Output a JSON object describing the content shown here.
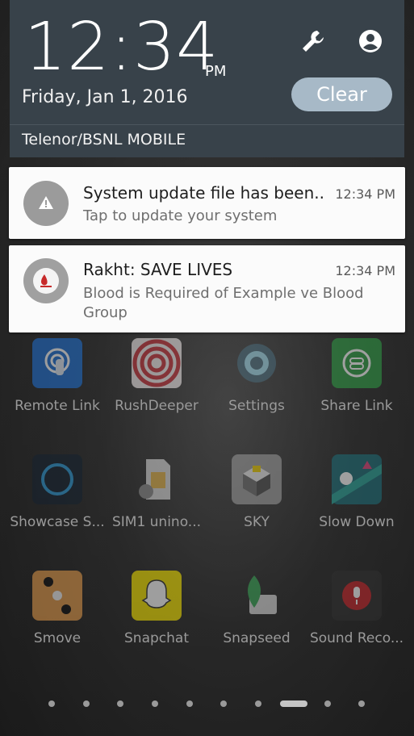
{
  "shade": {
    "time": "12:34",
    "ampm": "PM",
    "date": "Friday, Jan 1, 2016",
    "clear_label": "Clear",
    "carrier": "Telenor/BSNL MOBILE"
  },
  "notifications": [
    {
      "title": "System update file has been..",
      "time": "12:34 PM",
      "text": "Tap to update your system",
      "icon": "warning-icon"
    },
    {
      "title": "Rakht: SAVE LIVES",
      "time": "12:34 PM",
      "text": "Blood is Required of Example ve Blood Group",
      "icon": "rakht-logo-icon"
    }
  ],
  "apps": [
    {
      "label": "Remote Link",
      "icon": "remote-link-icon",
      "color": "#1f6fd1"
    },
    {
      "label": "RushDeeper",
      "icon": "rushdeeper-icon",
      "color": "#c4323a"
    },
    {
      "label": "Settings",
      "icon": "gear-icon",
      "color": "#4a6b7a"
    },
    {
      "label": "Share Link",
      "icon": "share-link-icon",
      "color": "#2f9e45"
    },
    {
      "label": "Showcase S...",
      "icon": "showcase-icon",
      "color": "#1e3a5a"
    },
    {
      "label": "SIM1 unino...",
      "icon": "sim-card-icon",
      "color": "#c9c9c9"
    },
    {
      "label": "SKY",
      "icon": "sky-cube-icon",
      "color": "#8a8a8a"
    },
    {
      "label": "Slow Down",
      "icon": "slow-down-icon",
      "color": "#2aa59a"
    },
    {
      "label": "Smove",
      "icon": "smove-icon",
      "color": "#e39b4b"
    },
    {
      "label": "Snapchat",
      "icon": "snapchat-ghost-icon",
      "color": "#f6e400"
    },
    {
      "label": "Snapseed",
      "icon": "snapseed-leaf-icon",
      "color": "#3aa657"
    },
    {
      "label": "Sound Reco...",
      "icon": "microphone-icon",
      "color": "#c8262b"
    }
  ],
  "colors": {
    "shade_bg": "#38424a",
    "clear_button": "#a7b9c7",
    "card_bg": "#fbfbfb"
  }
}
